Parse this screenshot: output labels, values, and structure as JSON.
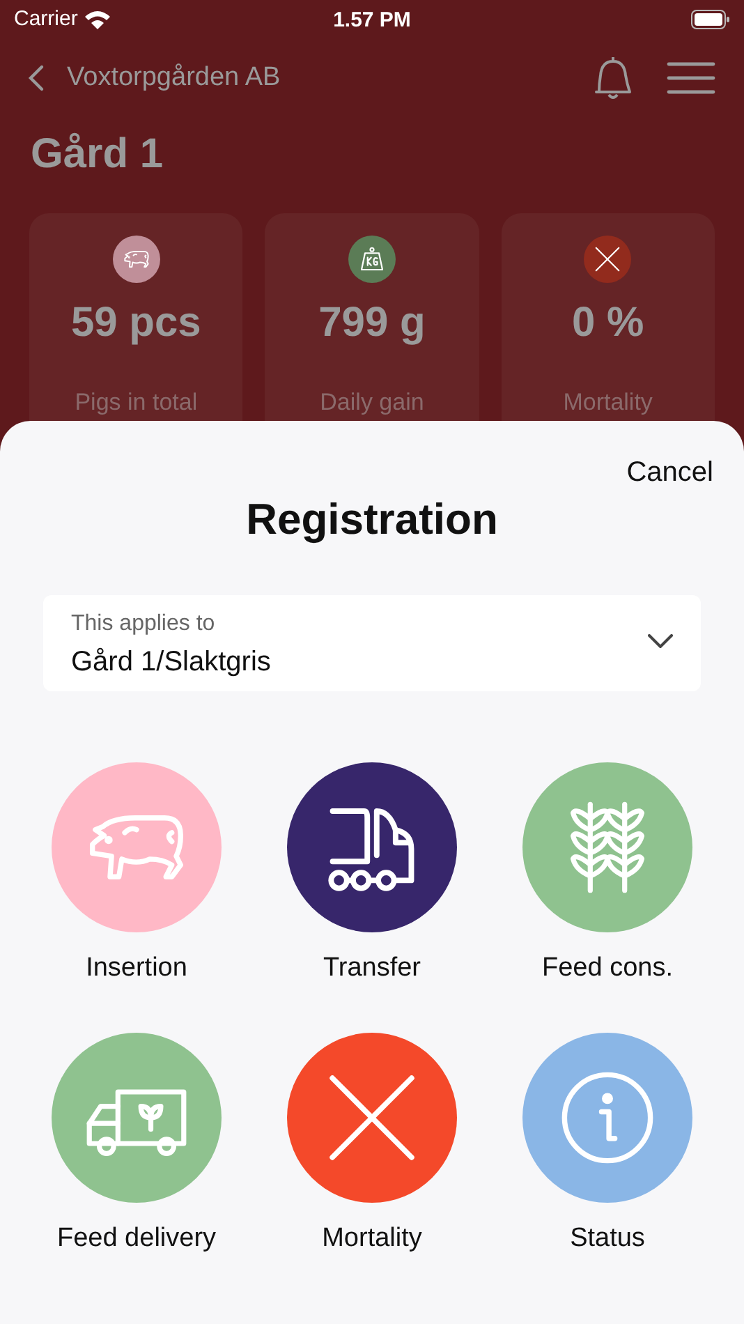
{
  "status_bar": {
    "carrier": "Carrier",
    "time": "1.57 PM"
  },
  "nav": {
    "back_label": "Voxtorpgården AB"
  },
  "page_title": "Gård 1",
  "stats": [
    {
      "kind": "pig",
      "color": "#c08f99",
      "value": "59 pcs",
      "label": "Pigs in total"
    },
    {
      "kind": "weight",
      "color": "#5b7c56",
      "value": "799 g",
      "label": "Daily gain"
    },
    {
      "kind": "cross",
      "color": "#922b1d",
      "value": "0 %",
      "label": "Mortality"
    }
  ],
  "sheet": {
    "cancel": "Cancel",
    "title": "Registration",
    "applies_to": {
      "label": "This applies to",
      "value": "Gård 1/Slaktgris"
    },
    "actions": [
      {
        "kind": "pig",
        "color": "#ffb8c6",
        "label": "Insertion"
      },
      {
        "kind": "transfer",
        "color": "#37266b",
        "label": "Transfer"
      },
      {
        "kind": "wheat",
        "color": "#8fc28f",
        "label": "Feed cons."
      },
      {
        "kind": "delivery",
        "color": "#8fc28f",
        "label": "Feed delivery"
      },
      {
        "kind": "cross",
        "color": "#f4492a",
        "label": "Mortality"
      },
      {
        "kind": "info",
        "color": "#8ab6e6",
        "label": "Status"
      }
    ]
  }
}
